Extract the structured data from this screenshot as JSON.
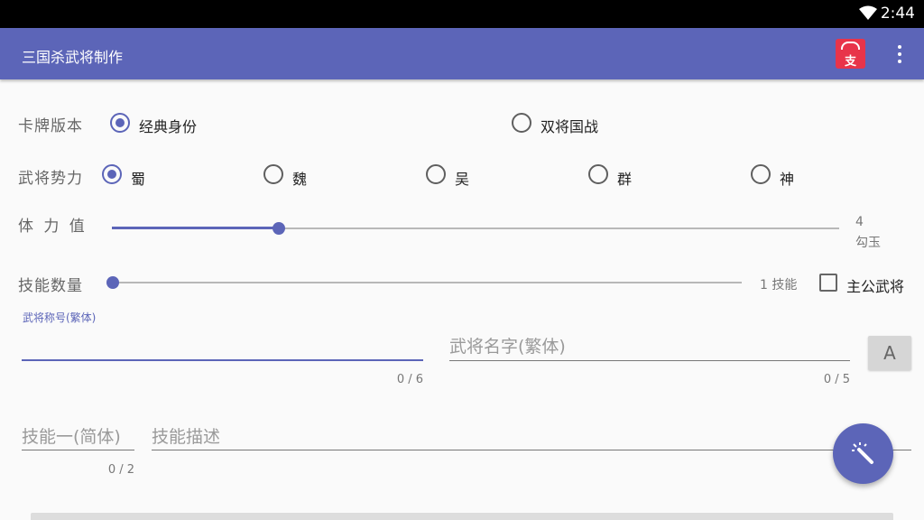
{
  "status_bar": {
    "time": "2:44",
    "wifi_icon": "wifi-icon"
  },
  "app_bar": {
    "title": "三国杀武将制作",
    "donate_icon": "alipay-icon",
    "donate_glyph": "支",
    "menu_icon": "more-vert-icon"
  },
  "card_version": {
    "label": "卡牌版本",
    "options": [
      "经典身份",
      "双将国战"
    ],
    "selected": "经典身份"
  },
  "faction": {
    "label": "武将势力",
    "options": [
      "蜀",
      "魏",
      "吴",
      "群",
      "神"
    ],
    "selected": "蜀"
  },
  "hp": {
    "label": "体 力 值",
    "value": "4",
    "unit": "勾玉",
    "slider_fraction": 0.23
  },
  "skill_count": {
    "label": "技能数量",
    "value_text": "1 技能",
    "slider_fraction": 0.0
  },
  "lord_checkbox": {
    "label": "主公武将",
    "checked": false
  },
  "title_field": {
    "floating_label": "武将称号(繁体)",
    "value": "",
    "counter": "0 / 6"
  },
  "name_field": {
    "placeholder": "武将名字(繁体)",
    "value": "",
    "counter": "0 / 5"
  },
  "font_button": {
    "label": "A"
  },
  "skill1_name_field": {
    "placeholder": "技能一(简体)",
    "counter": "0 / 2"
  },
  "skill1_desc_field": {
    "placeholder": "技能描述"
  },
  "fab": {
    "icon": "magic-wand-icon"
  },
  "colors": {
    "primary": "#5c65b8",
    "status_bar": "#000000",
    "background": "#fafafa",
    "donate_red": "#e8344a"
  }
}
